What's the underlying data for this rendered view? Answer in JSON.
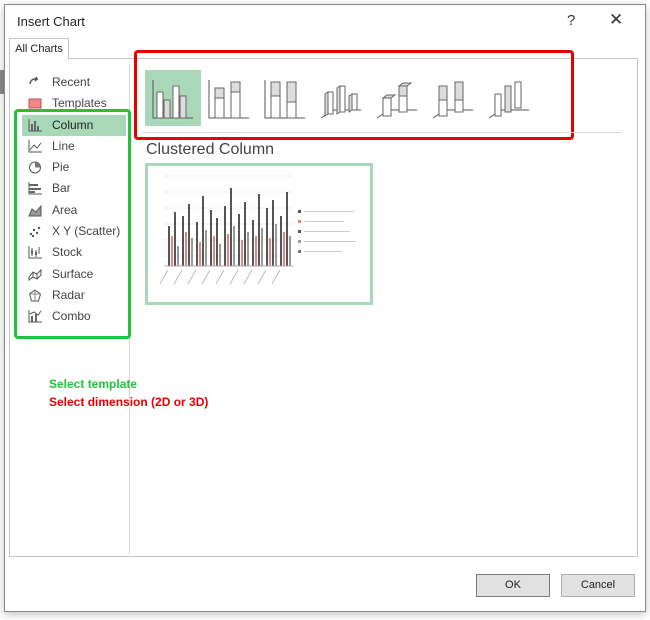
{
  "dialog": {
    "title": "Insert Chart",
    "help_glyph": "?",
    "close_glyph": "✕",
    "tab_label": "All Charts"
  },
  "categories": [
    {
      "label": "Recent",
      "icon": "recent-icon",
      "selected": false
    },
    {
      "label": "Templates",
      "icon": "templates-icon",
      "selected": false
    },
    {
      "label": "Column",
      "icon": "column-chart-icon",
      "selected": true
    },
    {
      "label": "Line",
      "icon": "line-chart-icon",
      "selected": false
    },
    {
      "label": "Pie",
      "icon": "pie-chart-icon",
      "selected": false
    },
    {
      "label": "Bar",
      "icon": "bar-chart-icon",
      "selected": false
    },
    {
      "label": "Area",
      "icon": "area-chart-icon",
      "selected": false
    },
    {
      "label": "X Y (Scatter)",
      "icon": "scatter-chart-icon",
      "selected": false
    },
    {
      "label": "Stock",
      "icon": "stock-chart-icon",
      "selected": false
    },
    {
      "label": "Surface",
      "icon": "surface-chart-icon",
      "selected": false
    },
    {
      "label": "Radar",
      "icon": "radar-chart-icon",
      "selected": false
    },
    {
      "label": "Combo",
      "icon": "combo-chart-icon",
      "selected": false
    }
  ],
  "chart_types": [
    {
      "icon": "clustered-column-icon",
      "selected": true
    },
    {
      "icon": "stacked-column-icon",
      "selected": false
    },
    {
      "icon": "100-stacked-column-icon",
      "selected": false
    },
    {
      "icon": "3d-clustered-column-icon",
      "selected": false
    },
    {
      "icon": "3d-stacked-column-icon",
      "selected": false
    },
    {
      "icon": "3d-100-stacked-column-icon",
      "selected": false
    },
    {
      "icon": "3d-column-icon",
      "selected": false
    }
  ],
  "selected_type_name": "Clustered Column",
  "annotations": {
    "green": "Select template",
    "red": "Select dimension (2D or 3D)",
    "green_color": "#22c33a",
    "red_color": "#e60000"
  },
  "buttons": {
    "ok": "OK",
    "cancel": "Cancel"
  },
  "colors": {
    "selection": "#a9d8b8"
  }
}
